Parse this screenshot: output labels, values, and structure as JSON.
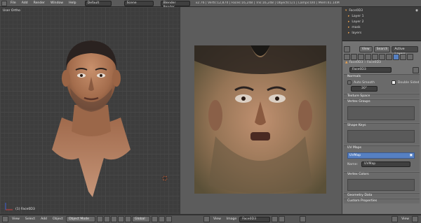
{
  "topbar": {
    "menus": [
      "File",
      "Add",
      "Render",
      "Window",
      "Help"
    ],
    "screen_field": "Default",
    "scene_field": "Scene",
    "engine_field": "Blender Render",
    "info_text": "v2.76 | Verts:12,874 | Faces:16,248 | Tris:16,248 | Objects:1/1 | Lamps:0/0 | Mem:41.14M"
  },
  "viewport": {
    "view_label": "User Ortho",
    "object_label": "(1) Face0D3"
  },
  "outliner": {
    "items": [
      "Face0D3",
      "Layer 1",
      "Layer 2",
      "mask",
      "layers"
    ]
  },
  "properties": {
    "tabs": [
      "View",
      "Search",
      "Active Layers"
    ],
    "object_name": "Face0D3",
    "object_name2": "Face0D3",
    "panel_normals": "Normals",
    "auto_smooth_label": "Auto Smooth",
    "double_sided_label": "Double Sided",
    "auto_smooth_value": "30°",
    "panel_texture_space": "Texture Space",
    "panel_vertex_groups": "Vertex Groups",
    "panel_shape_keys": "Shape Keys",
    "panel_uv_maps": "UV Maps",
    "uv_map_item": "UVMap",
    "name_label": "Name:",
    "name_value": "UVMap",
    "panel_vertex_colors": "Vertex Colors",
    "panel_geometry": "Geometry Data",
    "panel_custom": "Custom Properties"
  },
  "bottombar": {
    "view3d": [
      "View",
      "Select",
      "Add",
      "Object"
    ],
    "mode": "Object Mode",
    "pivot": "Global",
    "image": [
      "View",
      "Image"
    ],
    "image_name": "Face0D3"
  },
  "colors": {
    "accent_blue": "#5680c2",
    "panel_bg": "#737373",
    "viewport_bg": "#3d3d3d"
  }
}
